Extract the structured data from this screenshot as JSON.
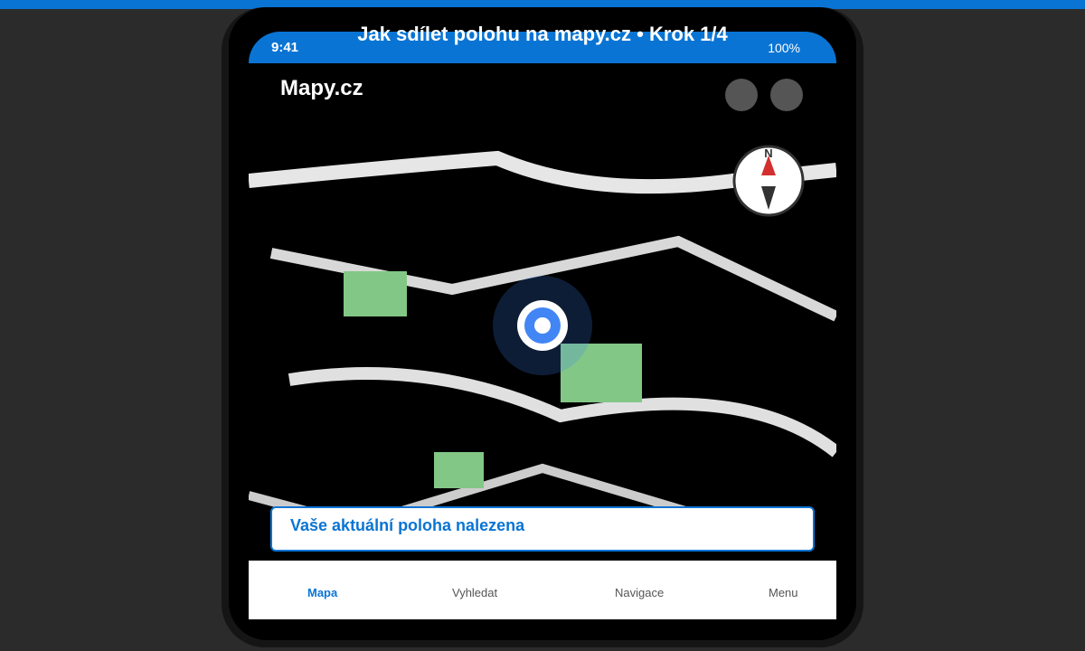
{
  "guide": {
    "title": "Jak sdílet polohu na mapy.cz • Krok 1/4"
  },
  "status_bar": {
    "time": "9:41",
    "battery": "100%"
  },
  "app": {
    "title": "Mapy.cz"
  },
  "compass": {
    "north_label": "N"
  },
  "toast": {
    "message": "Vaše aktuální poloha nalezena"
  },
  "bottom_nav": {
    "items": [
      {
        "label": "Mapa",
        "active": true
      },
      {
        "label": "Vyhledat",
        "active": false
      },
      {
        "label": "Navigace",
        "active": false
      },
      {
        "label": "Menu",
        "active": false
      }
    ]
  },
  "colors": {
    "accent": "#0a74d4",
    "map_background": "#000000",
    "road": "#e0e0e0",
    "park": "#82c785",
    "location_dot": "#4285f4",
    "compass_north": "#d32f2f",
    "compass_south": "#333333"
  }
}
